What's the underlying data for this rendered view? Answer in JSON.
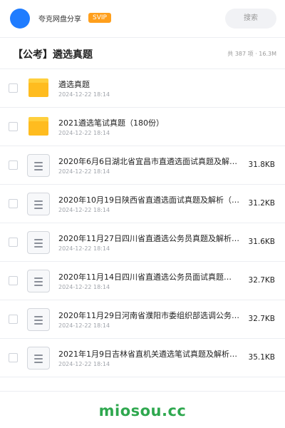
{
  "header": {
    "title": "夸克网盘分享",
    "badge": "SVIP",
    "search_label": "搜索"
  },
  "folder": {
    "title": "【公考】遴选真题",
    "meta": "共 387 项 · 16.3M"
  },
  "files": [
    {
      "name": "遴选真题",
      "date": "2024-12-22 18:14",
      "size": "",
      "icon": "folder-icon"
    },
    {
      "name": "2021遴选笔试真题（180份）",
      "date": "2024-12-22 18:14",
      "size": "",
      "icon": "folder-icon"
    },
    {
      "name": "2020年6月6日湖北省宜昌市直遴选面试真题及解析…",
      "date": "2024-12-22 18:14",
      "size": "31.8KB",
      "icon": "document-icon"
    },
    {
      "name": "2020年10月19日陕西省直遴选面试真题及解析（…",
      "date": "2024-12-22 18:14",
      "size": "31.2KB",
      "icon": "document-icon"
    },
    {
      "name": "2020年11月27日四川省直遴选公务员真题及解析…",
      "date": "2024-12-22 18:14",
      "size": "31.6KB",
      "icon": "document-icon"
    },
    {
      "name": "2020年11月14日四川省直遴选公务员面试真题…",
      "date": "2024-12-22 18:14",
      "size": "32.7KB",
      "icon": "document-icon"
    },
    {
      "name": "2020年11月29日河南省濮阳市委组织部选调公务…",
      "date": "2024-12-22 18:14",
      "size": "32.7KB",
      "icon": "document-icon"
    },
    {
      "name": "2021年1月9日吉林省直机关遴选笔试真题及解析（…",
      "date": "2024-12-22 18:14",
      "size": "35.1KB",
      "icon": "document-icon"
    }
  ],
  "watermark": "miosou.cc",
  "colors": {
    "avatar": "#1f7cff",
    "svip_badge": "#ff9f1c",
    "folder": "#ffbc1f",
    "watermark": "#2fa84f"
  }
}
